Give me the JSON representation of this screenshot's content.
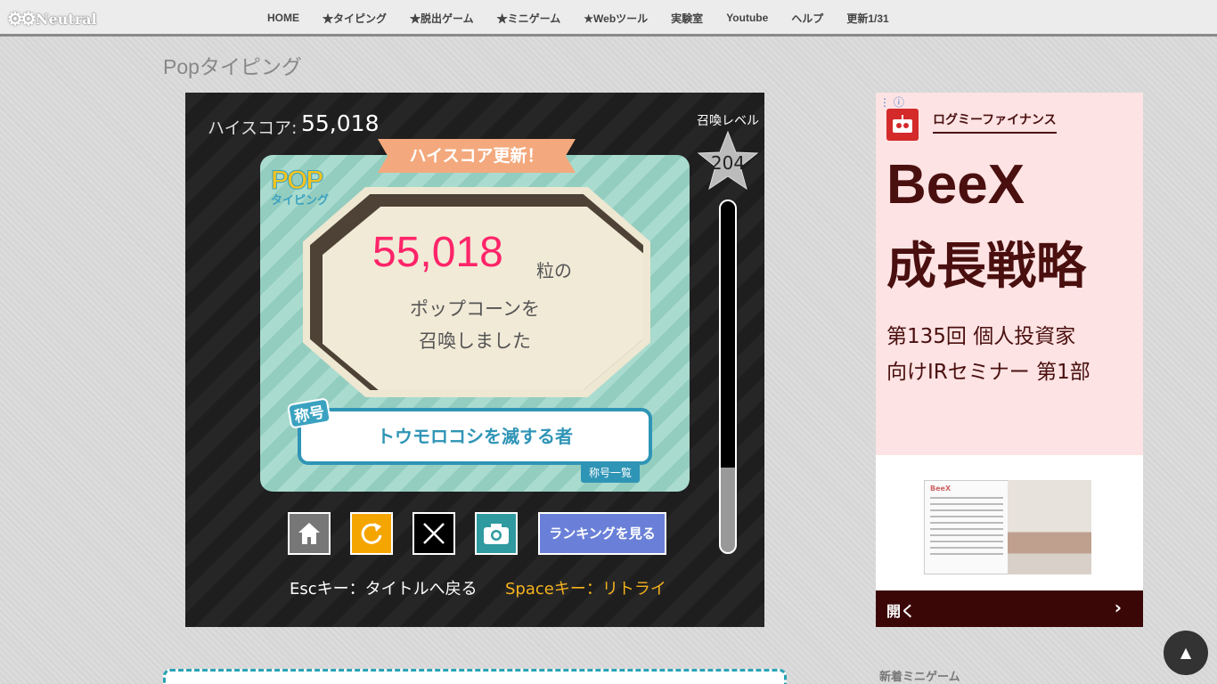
{
  "site": {
    "name": "Neutral"
  },
  "nav": {
    "items": [
      "HOME",
      "★タイピング",
      "★脱出ゲーム",
      "★ミニゲーム",
      "★Webツール",
      "実験室",
      "Youtube",
      "ヘルプ",
      "更新1/31"
    ]
  },
  "page": {
    "title": "Popタイピング"
  },
  "game": {
    "hiscore_label": "ハイスコア:",
    "hiscore_value": "55,018",
    "summon_level_label": "召喚レベル",
    "summon_level": "204",
    "gauge_fraction": 0.76,
    "ribbon": "ハイスコア更新！",
    "logo_pop": "POP",
    "logo_typing": "タイピング",
    "score": "55,018",
    "score_unit": "粒の",
    "message_line1": "ポップコーンを",
    "message_line2": "召喚しました",
    "title_tag": "称号",
    "title_value": "トウモロコシを滅する者",
    "title_list": "称号一覧",
    "ranking_button": "ランキングを見る",
    "hint_esc": "Escキー：タイトルへ戻る",
    "hint_space": "Spaceキー：リトライ"
  },
  "ad": {
    "brand": "ログミーファイナンス",
    "headline1": "BeeX",
    "headline2": "成長戦略",
    "line1": "第135回 個人投資家",
    "line2": "向けIRセミナー 第1部",
    "doc_header": "BeeX",
    "open_label": "開く",
    "open_chevron": "›"
  },
  "sidebar": {
    "new_minigames": "新着ミニゲーム"
  },
  "totop": {
    "label": "▲"
  },
  "colors": {
    "score": "#ff2469",
    "accent": "#2f95b6",
    "ribbon": "#f3a97d"
  },
  "icons": [
    "gear-icon",
    "home-icon",
    "retry-icon",
    "x-icon",
    "camera-icon",
    "star-icon",
    "info-icon",
    "robot-icon"
  ]
}
